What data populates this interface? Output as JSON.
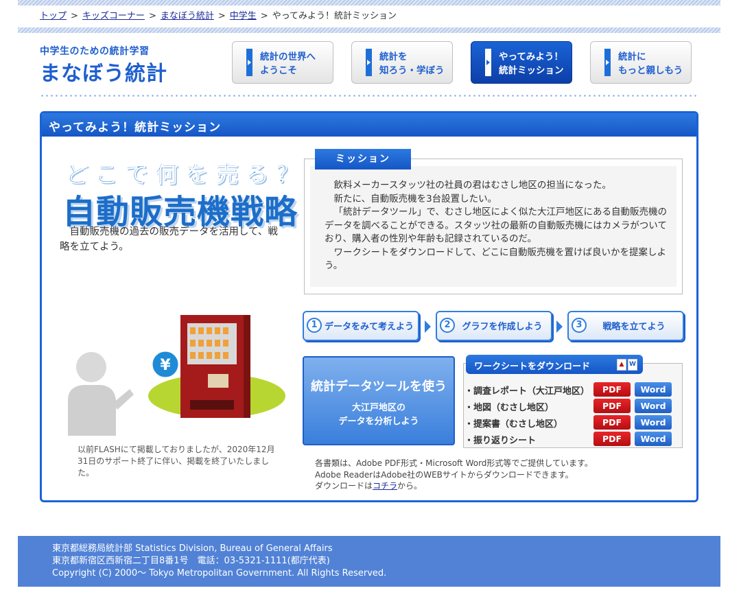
{
  "breadcrumb": {
    "items": [
      "トップ",
      "キッズコーナー",
      "まなぼう統計",
      "中学生"
    ],
    "separator": ">",
    "current": "やってみよう！統計ミッション"
  },
  "logo": {
    "sub": "中学生のための統計学習",
    "main": "まなぼう統計"
  },
  "nav": [
    {
      "line1": "統計の世界へ",
      "line2": "ようこそ",
      "active": false
    },
    {
      "line1": "統計を",
      "line2": "知ろう・学ぼう",
      "active": false
    },
    {
      "line1": "やってみよう！",
      "line2": "統計ミッション",
      "active": true
    },
    {
      "line1": "統計に",
      "line2": "もっと親しもう",
      "active": false
    }
  ],
  "panel": {
    "title": "やってみよう！統計ミッション"
  },
  "hero": {
    "tagline": "どこで何を売る？",
    "title": "自動販売機戦略",
    "description": "自動販売機の過去の販売データを活用して、戦略を立てよう。"
  },
  "flash_note": "以前FLASHにて掲載しておりましたが、2020年12月31日のサポート終了に伴い、掲載を終了いたしました。",
  "mission": {
    "tab": "ミッション",
    "paragraphs": [
      "飲料メーカースタッツ社の社員の君はむさし地区の担当になった。",
      "新たに、自動販売機を3台設置したい。",
      "「統計データツール」で、むさし地区によく似た大江戸地区にある自動販売機のデータを調べることができる。スタッツ社の最新の自動販売機にはカメラがついており、購入者の性別や年齢も記録されているのだ。",
      "ワークシートをダウンロードして、どこに自動販売機を置けば良いかを提案しよう。"
    ]
  },
  "steps": [
    {
      "num": "1",
      "label": "データをみて考えよう"
    },
    {
      "num": "2",
      "label": "グラフを作成しよう"
    },
    {
      "num": "3",
      "label": "戦略を立てよう"
    }
  ],
  "tool_button": {
    "title": "統計データツールを使う",
    "line1": "大江戸地区の",
    "line2": "データを分析しよう"
  },
  "downloads": {
    "header": "ワークシートをダウンロード",
    "pdf_label": "PDF",
    "word_label": "Word",
    "rows": [
      "・調査レポート（大江戸地区）",
      "・地図（むさし地区）",
      "・提案書（むさし地区）",
      "・振り返りシート"
    ]
  },
  "formats": {
    "line1": "各書類は、Adobe PDF形式・Microsoft Word形式等でご提供しています。",
    "line2": "Adobe ReaderはAdobe社のWEBサイトからダウンロードできます。",
    "line3_pre": "ダウンロードは",
    "line3_link": "コチラ",
    "line3_post": "から。"
  },
  "yen_symbol": "¥",
  "footer": {
    "line1": "東京都総務局統計部 Statistics Division, Bureau of General Affairs",
    "line2": "東京都新宿区西新宿二丁目8番1号　電話：03-5321-1111(都庁代表)",
    "line3": "Copyright (C) 2000〜 Tokyo Metropolitan Government. All Rights Reserved."
  },
  "colors": {
    "brand_blue": "#1a63d6",
    "footer_blue": "#5182d6",
    "pdf_red": "#d11a1f",
    "word_blue": "#2f6fd6"
  }
}
